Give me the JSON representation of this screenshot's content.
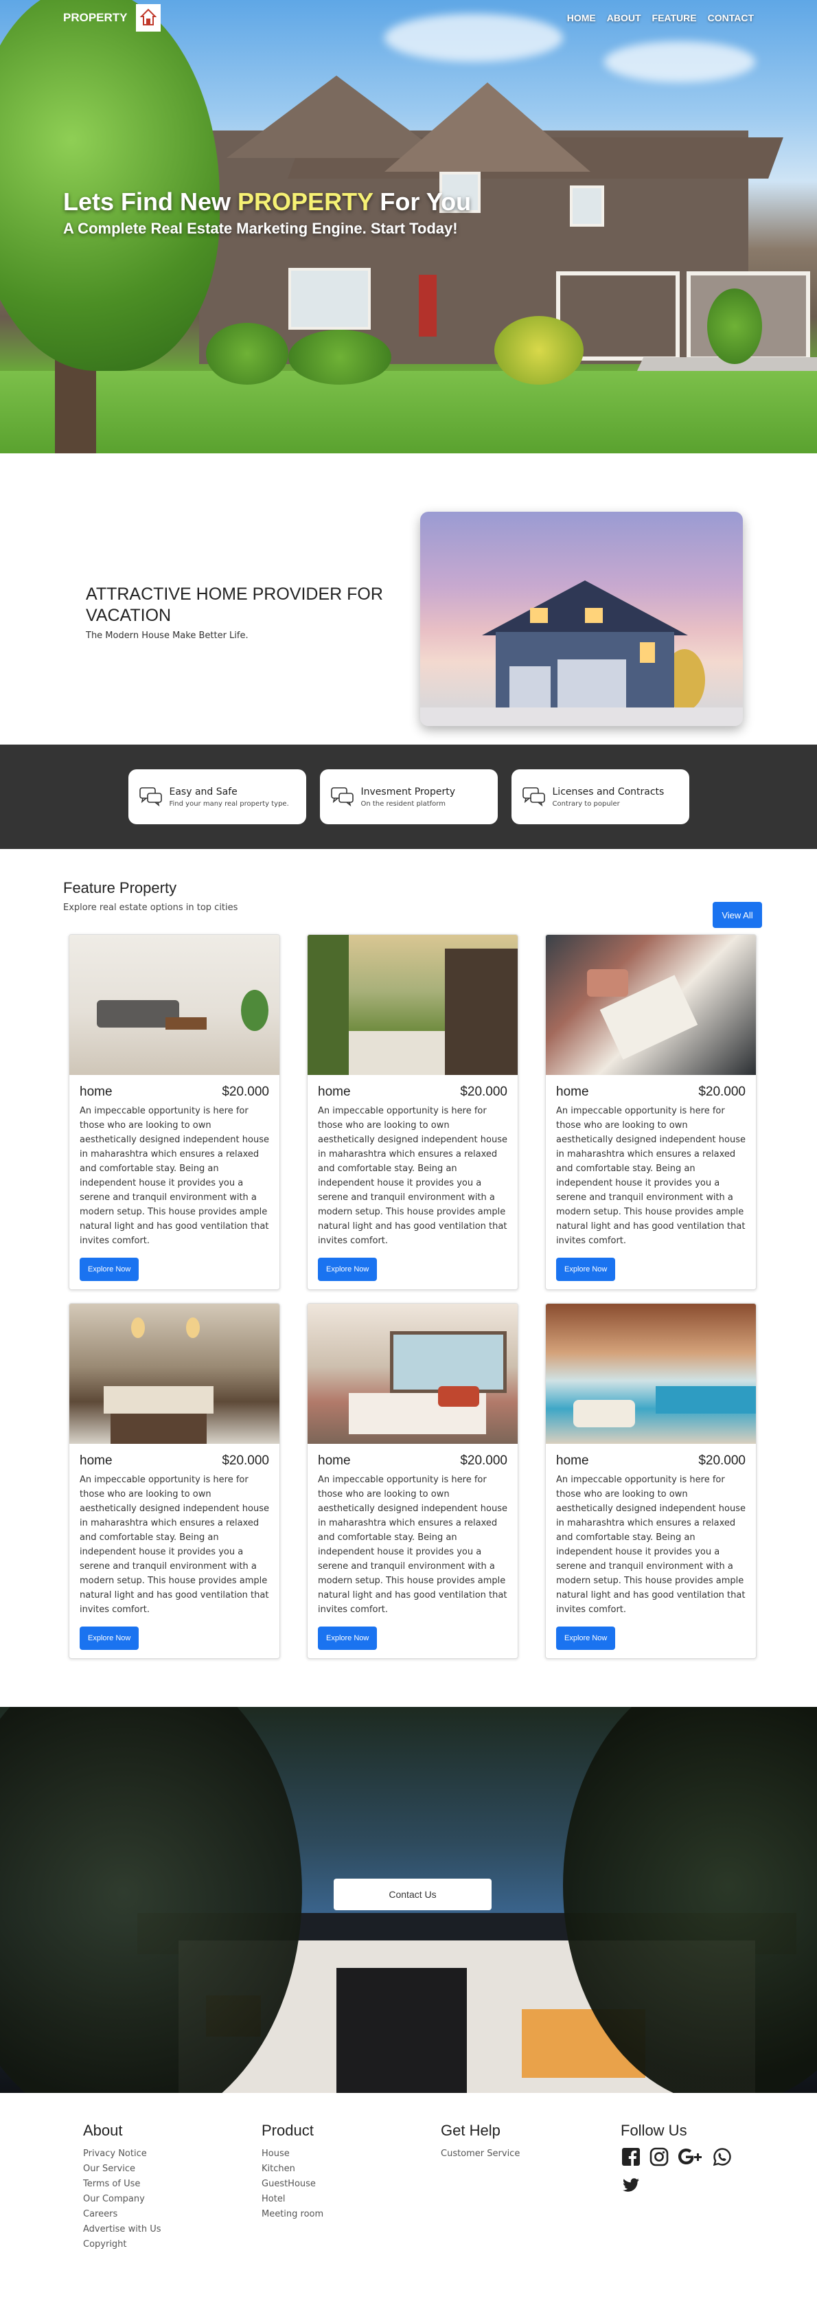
{
  "nav": {
    "brand": "PROPERTY",
    "links": [
      "HOME",
      "ABOUT",
      "FEATURE",
      "CONTACT"
    ]
  },
  "hero": {
    "title_prefix": "Lets Find New ",
    "title_highlight": "PROPERTY",
    "title_suffix": " For You",
    "subtitle": "A Complete Real Estate Marketing Engine. Start Today!",
    "highlight_color": "#f6f174"
  },
  "about": {
    "heading": "ATTRACTIVE HOME PROVIDER FOR VACATION",
    "text": "The Modern House Make Better Life."
  },
  "features": [
    {
      "title": "Easy and Safe",
      "subtitle": "Find your many real property type.",
      "icon": "chat-bubbles-icon"
    },
    {
      "title": "Invesment Property",
      "subtitle": "On the resident platform",
      "icon": "chat-bubbles-icon"
    },
    {
      "title": "Licenses and Contracts",
      "subtitle": "Contrary to populer",
      "icon": "chat-bubbles-icon"
    }
  ],
  "properties": {
    "heading": "Feature Property",
    "subheading": "Explore real estate options in top cities",
    "view_all": "View All",
    "cards": [
      {
        "name": "home",
        "price": "$20.000",
        "desc": "An impeccable opportunity is here for those who are looking to own aesthetically designed independent house in maharashtra which ensures a relaxed and comfortable stay. Being an independent house it provides you a serene and tranquil environment with a modern setup. This house provides ample natural light and has good ventilation that invites comfort.",
        "button": "Explore Now"
      },
      {
        "name": "home",
        "price": "$20.000",
        "desc": "An impeccable opportunity is here for those who are looking to own aesthetically designed independent house in maharashtra which ensures a relaxed and comfortable stay. Being an independent house it provides you a serene and tranquil environment with a modern setup. This house provides ample natural light and has good ventilation that invites comfort.",
        "button": "Explore Now"
      },
      {
        "name": "home",
        "price": "$20.000",
        "desc": "An impeccable opportunity is here for those who are looking to own aesthetically designed independent house in maharashtra which ensures a relaxed and comfortable stay. Being an independent house it provides you a serene and tranquil environment with a modern setup. This house provides ample natural light and has good ventilation that invites comfort.",
        "button": "Explore Now"
      },
      {
        "name": "home",
        "price": "$20.000",
        "desc": "An impeccable opportunity is here for those who are looking to own aesthetically designed independent house in maharashtra which ensures a relaxed and comfortable stay. Being an independent house it provides you a serene and tranquil environment with a modern setup. This house provides ample natural light and has good ventilation that invites comfort.",
        "button": "Explore Now"
      },
      {
        "name": "home",
        "price": "$20.000",
        "desc": "An impeccable opportunity is here for those who are looking to own aesthetically designed independent house in maharashtra which ensures a relaxed and comfortable stay. Being an independent house it provides you a serene and tranquil environment with a modern setup. This house provides ample natural light and has good ventilation that invites comfort.",
        "button": "Explore Now"
      },
      {
        "name": "home",
        "price": "$20.000",
        "desc": "An impeccable opportunity is here for those who are looking to own aesthetically designed independent house in maharashtra which ensures a relaxed and comfortable stay. Being an independent house it provides you a serene and tranquil environment with a modern setup. This house provides ample natural light and has good ventilation that invites comfort.",
        "button": "Explore Now"
      }
    ]
  },
  "contact": {
    "button": "Contact Us"
  },
  "footer": {
    "about": {
      "title": "About",
      "links": [
        "Privacy Notice",
        "Our Service",
        "Terms of Use",
        "Our Company",
        "Careers",
        "Advertise with Us",
        "Copyright"
      ]
    },
    "product": {
      "title": "Product",
      "links": [
        "House",
        "Kitchen",
        "GuestHouse",
        "Hotel",
        "Meeting room"
      ]
    },
    "help": {
      "title": "Get Help",
      "links": [
        "Customer Service"
      ]
    },
    "follow": {
      "title": "Follow Us",
      "icons": [
        "facebook-icon",
        "instagram-icon",
        "google-plus-icon",
        "whatsapp-icon",
        "twitter-icon"
      ]
    }
  },
  "colors": {
    "accent": "#1a73f0",
    "dark_band": "#343434"
  }
}
